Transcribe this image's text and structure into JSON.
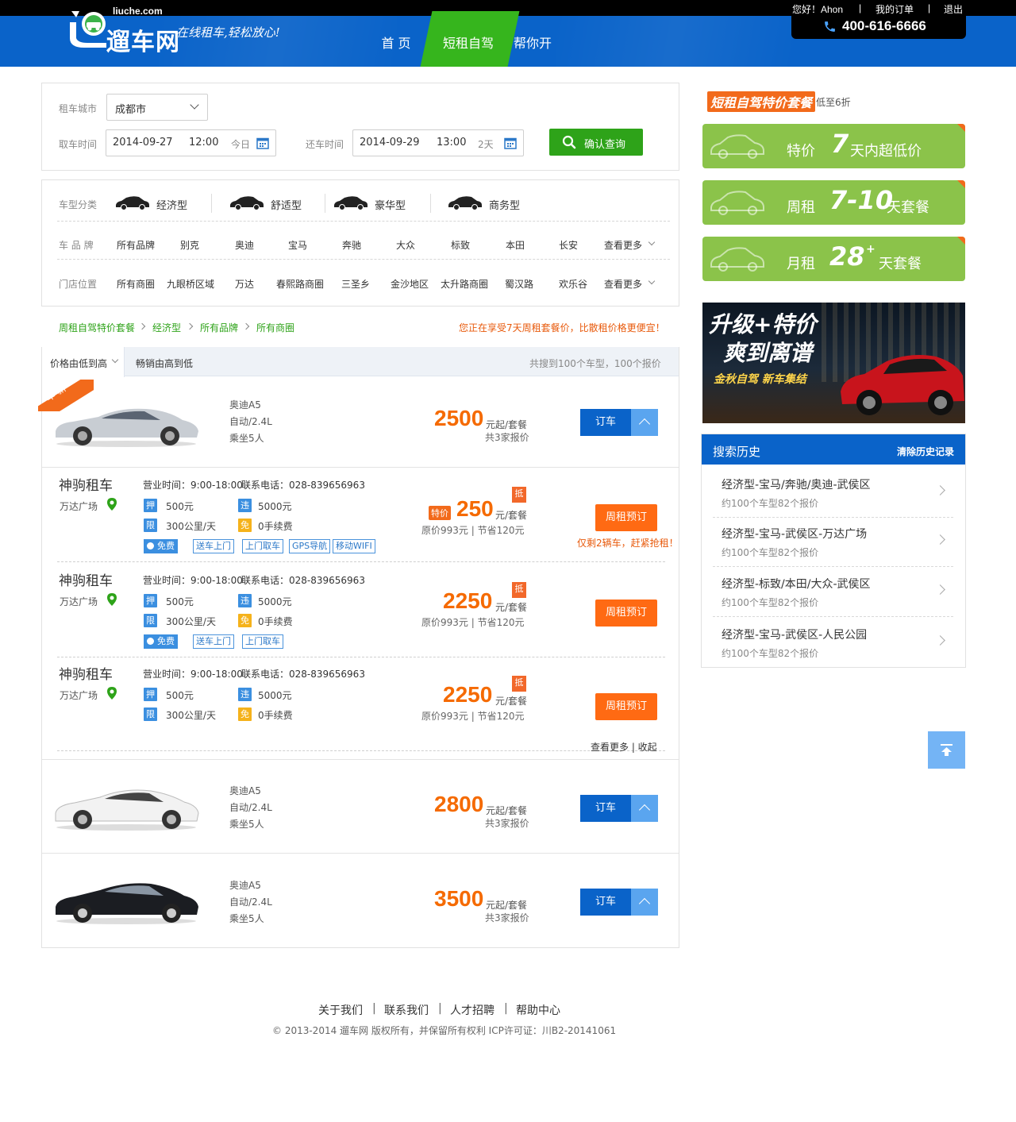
{
  "colors": {
    "brand_blue": "#0a63c9",
    "nav_green": "#36b51d",
    "accent_orange": "#f56a00",
    "promo_green": "#8bc34a",
    "button_green": "#2ea319"
  },
  "topbar": {
    "greeting": "您好！Ahon",
    "sep1": "|",
    "orders": "我的订单",
    "sep2": "|",
    "logout": "退出",
    "phone": "400-616-6666"
  },
  "header": {
    "logo_cn": "遛车网",
    "logo_en": "liuche.com",
    "slogan": "在线租车,轻松放心!",
    "nav": [
      "首 页",
      "短租自驾",
      "帮你开"
    ]
  },
  "search": {
    "city_label": "租车城市",
    "city_value": "成都市",
    "pickup_label": "取车时间",
    "pickup_date": "2014-09-27",
    "pickup_time": "12:00",
    "pickup_hint": "今日",
    "return_label": "还车时间",
    "return_date": "2014-09-29",
    "return_time": "13:00",
    "return_hint": "2天",
    "submit": "确认查询"
  },
  "filters": {
    "type_label": "车型分类",
    "types": [
      "经济型",
      "舒适型",
      "豪华型",
      "商务型"
    ],
    "brand_label": "车 品 牌",
    "brands": [
      "所有品牌",
      "别克",
      "奥迪",
      "宝马",
      "奔驰",
      "大众",
      "标致",
      "本田",
      "长安"
    ],
    "brand_more": "查看更多",
    "store_label": "门店位置",
    "stores": [
      "所有商圈",
      "九眼桥区域",
      "万达",
      "春熙路商圈",
      "三圣乡",
      "金沙地区",
      "太升路商圈",
      "蜀汉路",
      "欢乐谷"
    ],
    "store_more": "查看更多"
  },
  "breadcrumb": {
    "items": [
      "周租自驾特价套餐",
      "经济型",
      "所有品牌",
      "所有商圈"
    ],
    "notice": "您正在享受7天周租套餐价，比散租价格更便宜！"
  },
  "sort": {
    "price": "价格由低到高",
    "sales": "畅销由高到低",
    "summary": "共搜到100个车型，100个报价"
  },
  "cars": [
    {
      "badge": "车 新",
      "model": "奥迪A5",
      "spec": "自动/2.4L",
      "seats": "乘坐5人",
      "price": "2500",
      "unit": "元起/套餐",
      "quotes": "共3家报价",
      "button": "订车"
    },
    {
      "model": "奥迪A5",
      "spec": "自动/2.4L",
      "seats": "乘坐5人",
      "price": "2800",
      "unit": "元起/套餐",
      "quotes": "共3家报价",
      "button": "订车"
    },
    {
      "model": "奥迪A5",
      "spec": "自动/2.4L",
      "seats": "乘坐5人",
      "price": "3500",
      "unit": "元起/套餐",
      "quotes": "共3家报价",
      "button": "订车"
    }
  ],
  "stores": [
    {
      "name": "神驹租车",
      "loc": "万达广场",
      "hours": "营业时间：9:00-18:00",
      "phone": "联系电话：028-839656963",
      "deposit_tag": "押",
      "deposit": "500元",
      "violation_tag": "违",
      "violation": "5000元",
      "limit_tag": "限",
      "limit": "300公里/天",
      "free_tag": "免",
      "free": "0手续费",
      "special": "特价",
      "price": "250",
      "unit": "元/套餐",
      "orig": "原价993元 | 节省120元",
      "ribbon": "抵",
      "services": [
        "免费",
        "送车上门",
        "上门取车",
        "GPS导航",
        "移动WIFI"
      ],
      "button": "周租预订",
      "hint": "仅剩2辆车，赶紧抢租！"
    },
    {
      "name": "神驹租车",
      "loc": "万达广场",
      "hours": "营业时间：9:00-18:00",
      "phone": "联系电话：028-839656963",
      "deposit_tag": "押",
      "deposit": "500元",
      "violation_tag": "违",
      "violation": "5000元",
      "limit_tag": "限",
      "limit": "300公里/天",
      "free_tag": "免",
      "free": "0手续费",
      "price": "2250",
      "unit": "元/套餐",
      "orig": "原价993元 | 节省120元",
      "ribbon": "抵",
      "services": [
        "免费",
        "送车上门",
        "上门取车"
      ],
      "button": "周租预订"
    },
    {
      "name": "神驹租车",
      "loc": "万达广场",
      "hours": "营业时间：9:00-18:00",
      "phone": "联系电话：028-839656963",
      "deposit_tag": "押",
      "deposit": "500元",
      "violation_tag": "违",
      "violation": "5000元",
      "limit_tag": "限",
      "limit": "300公里/天",
      "free_tag": "免",
      "free": "0手续费",
      "price": "2250",
      "unit": "元/套餐",
      "orig": "原价993元 | 节省120元",
      "ribbon": "抵",
      "button": "周租预订"
    }
  ],
  "more": {
    "label": "查看更多 | 收起"
  },
  "sidebar": {
    "title": "短租自驾特价套餐",
    "title_sub": "低至6折",
    "promos": [
      {
        "label": "特价",
        "num": "7",
        "tail": "天内超低价"
      },
      {
        "label": "周租",
        "num": "7-10",
        "tail": "天套餐"
      },
      {
        "label": "月租",
        "num": "28",
        "sup": "+",
        "tail": "天套餐"
      }
    ],
    "banner": {
      "line1": "升级+特价",
      "line2": "爽到离谱",
      "line3": "金秋自驾 新车集结"
    },
    "history_title": "搜索历史",
    "history_clear": "清除历史记录",
    "history": [
      {
        "title": "经济型-宝马/奔驰/奥迪-武侯区",
        "sub": "约100个车型82个报价"
      },
      {
        "title": "经济型-宝马-武侯区-万达广场",
        "sub": "约100个车型82个报价"
      },
      {
        "title": "经济型-标致/本田/大众-武侯区",
        "sub": "约100个车型82个报价"
      },
      {
        "title": "经济型-宝马-武侯区-人民公园",
        "sub": "约100个车型82个报价"
      }
    ]
  },
  "footer": {
    "links": [
      "关于我们",
      "联系我们",
      "人才招聘",
      "帮助中心"
    ],
    "sep": "|",
    "copyright": "© 2013-2014 遛车网 版权所有，并保留所有权利   ICP许可证：川B2-20141061"
  }
}
